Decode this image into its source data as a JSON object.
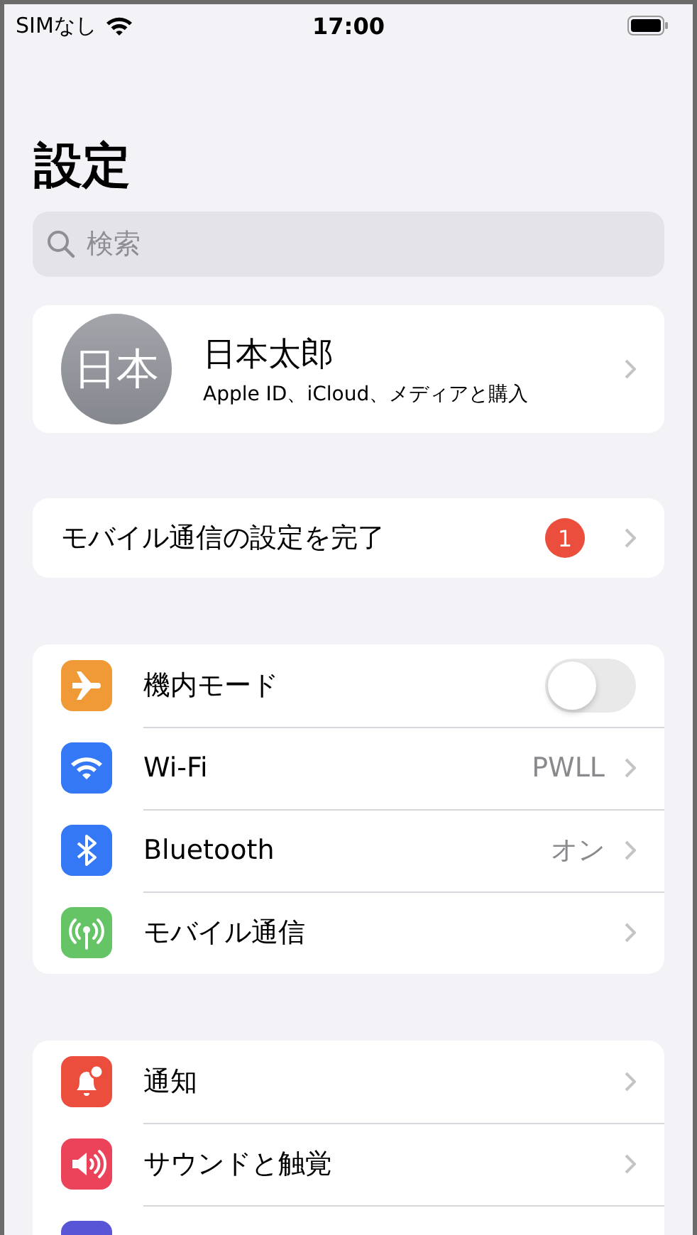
{
  "status_bar": {
    "carrier": "SIMなし",
    "time": "17:00"
  },
  "title": "設定",
  "search": {
    "placeholder": "検索"
  },
  "profile": {
    "initials": "日本",
    "name": "日本太郎",
    "subtitle": "Apple ID、iCloud、メディアと購入"
  },
  "setup": {
    "label": "モバイル通信の設定を完了",
    "badge": "1"
  },
  "groups": [
    {
      "rows": [
        {
          "kind": "toggle",
          "label": "機内モード",
          "on": false,
          "color": "#f09a37"
        },
        {
          "kind": "link",
          "label": "Wi-Fi",
          "value": "PWLL",
          "color": "#3478f6"
        },
        {
          "kind": "link",
          "label": "Bluetooth",
          "value": "オン",
          "color": "#3478f6"
        },
        {
          "kind": "link",
          "label": "モバイル通信",
          "color": "#65c466"
        }
      ]
    },
    {
      "rows": [
        {
          "kind": "link",
          "label": "通知",
          "color": "#eb4e3d"
        },
        {
          "kind": "link",
          "label": "サウンドと触覚",
          "color": "#eb445a"
        },
        {
          "kind": "link",
          "color": "#5856d6"
        }
      ]
    }
  ]
}
